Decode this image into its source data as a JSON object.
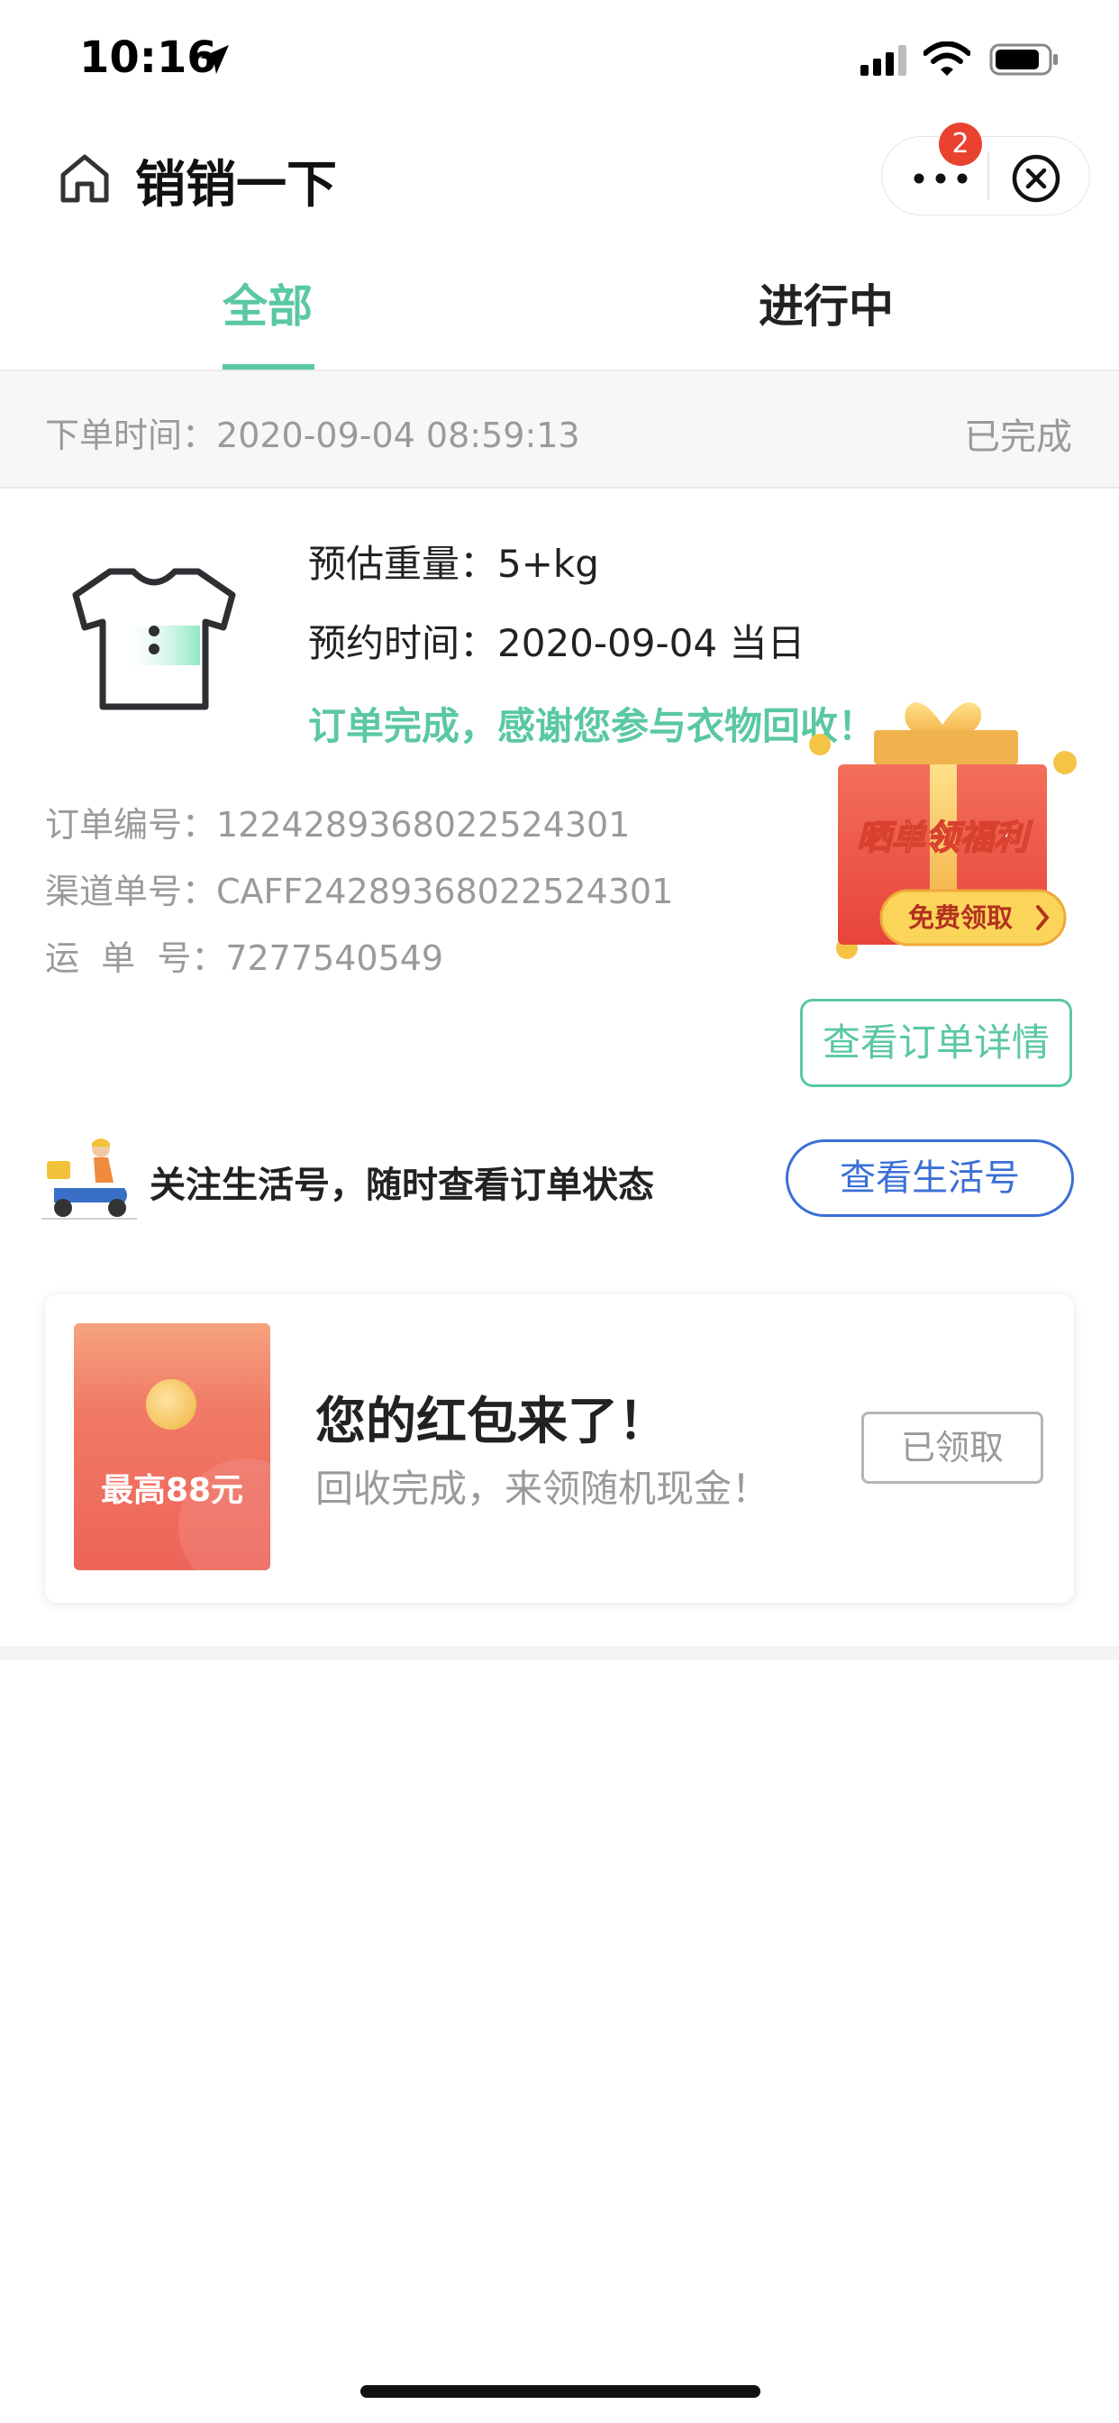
{
  "status_bar": {
    "time": "10:16",
    "location_icon": "location-arrow-icon",
    "signal_icon": "cellular-signal-icon",
    "wifi_icon": "wifi-icon",
    "battery_icon": "battery-icon"
  },
  "nav": {
    "title": "销销一下",
    "home_icon": "home-icon",
    "more_icon": "more-dots-icon",
    "close_icon": "close-circle-icon",
    "badge_count": "2"
  },
  "tabs": [
    {
      "label": "全部",
      "active": true
    },
    {
      "label": "进行中",
      "active": false
    }
  ],
  "order": {
    "time_label": "下单时间：",
    "time_value": "2020-09-04 08:59:13",
    "status": "已完成",
    "weight_label": "预估重量：",
    "weight_value": "5+kg",
    "appt_label": "预约时间：",
    "appt_value": "2020-09-04 当日",
    "done_message": "订单完成，感谢您参与衣物回收！",
    "order_no_label": "订单编号：",
    "order_no": "1224289368022524301",
    "channel_no_label": "渠道单号：",
    "channel_no": "CAFF24289368022524301",
    "waybill_label": "运  单  号：",
    "waybill_no": "7277540549",
    "detail_button": "查看订单详情",
    "gift": {
      "title": "晒单领福利",
      "cta": "免费领取"
    }
  },
  "life_account": {
    "text": "关注生活号，随时查看订单状态",
    "button": "查看生活号"
  },
  "red_packet": {
    "amount_label": "最高88元",
    "title": "您的红包来了！",
    "subtitle": "回收完成，来领随机现金！",
    "button": "已领取"
  },
  "colors": {
    "accent_green": "#5ac8a0",
    "link_blue": "#3b6fd6",
    "badge_red": "#e9432f",
    "gray_text": "#9a9a9a"
  }
}
